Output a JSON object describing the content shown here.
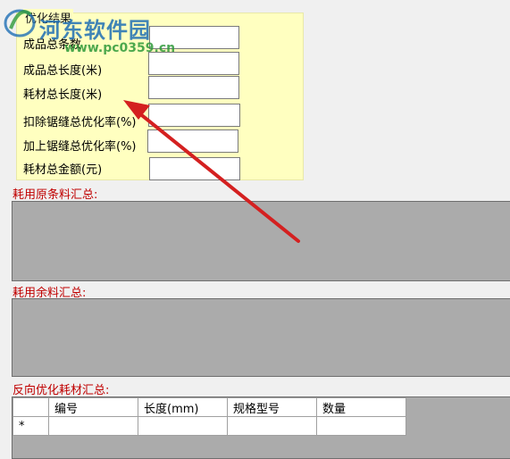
{
  "result_panel": {
    "title": "优化结果",
    "rows": [
      {
        "label": "成品总条数",
        "value": ""
      },
      {
        "label": "成品总长度(米)",
        "value": ""
      },
      {
        "label": "耗材总长度(米)",
        "value": ""
      },
      {
        "label": "扣除锯缝总优化率(%)",
        "value": ""
      },
      {
        "label": "加上锯缝总优化率(%)",
        "value": ""
      },
      {
        "label": "耗材总金额(元)",
        "value": ""
      }
    ]
  },
  "sections": {
    "raw_material_summary": "耗用原条料汇总:",
    "remnant_summary": "耗用余料汇总:",
    "reverse_summary": "反向优化耗材汇总:"
  },
  "grid": {
    "columns": [
      "",
      "编号",
      "长度(mm)",
      "规格型号",
      "数量"
    ],
    "new_row_marker": "*"
  },
  "watermark": {
    "site_name": "河东软件园",
    "url": "www.pc0359.cn"
  },
  "colors": {
    "panel_bg": "#ffffc0",
    "section_label": "#c00000",
    "arrow": "#d42020"
  }
}
